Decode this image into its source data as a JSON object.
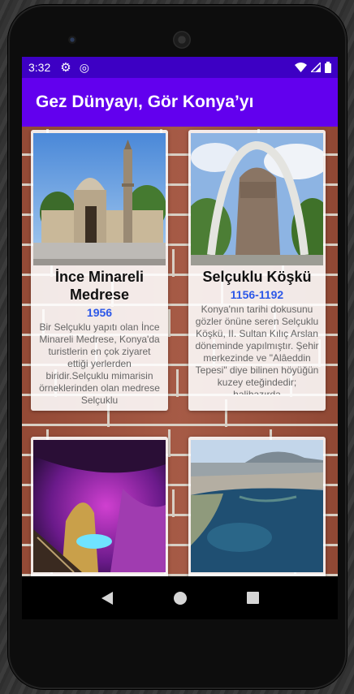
{
  "status_bar": {
    "time": "3:32",
    "icons": [
      "gear-icon",
      "sync-icon",
      "wifi-icon",
      "signal-icon",
      "battery-icon"
    ]
  },
  "app_bar": {
    "title": "Gez Dünyayı, Gör Konya’yı"
  },
  "cards": [
    {
      "title": "İnce Minareli Medrese",
      "year": "1956",
      "description": "Bir Selçuklu yapıtı olan İnce Minareli Medrese, Konya'da turistlerin en çok ziyaret ettiği yerlerden biridir.Selçuklu mimarisin örneklerinden olan medrese Selçuklu"
    },
    {
      "title": "Selçuklu Köşkü",
      "year": "1156-1192",
      "description": "Konya'nın tarihi dokusunu gözler önüne seren Selçuklu Köşkü, II. Sultan Kılıç Arslan döneminde yapılmıştır. Şehir merkezinde ve \"Alâeddin Tepesi\" diye bilinen höyüğün kuzey eteğindedir; halihazırda"
    },
    {
      "title": "",
      "year": "",
      "description": ""
    },
    {
      "title": "",
      "year": "",
      "description": ""
    }
  ],
  "colors": {
    "status_bar": "#3d00c4",
    "app_bar": "#6200ee",
    "year_text": "#2c58e8"
  },
  "nav_bar": {
    "buttons": [
      "back-icon",
      "home-icon",
      "recents-icon"
    ]
  }
}
